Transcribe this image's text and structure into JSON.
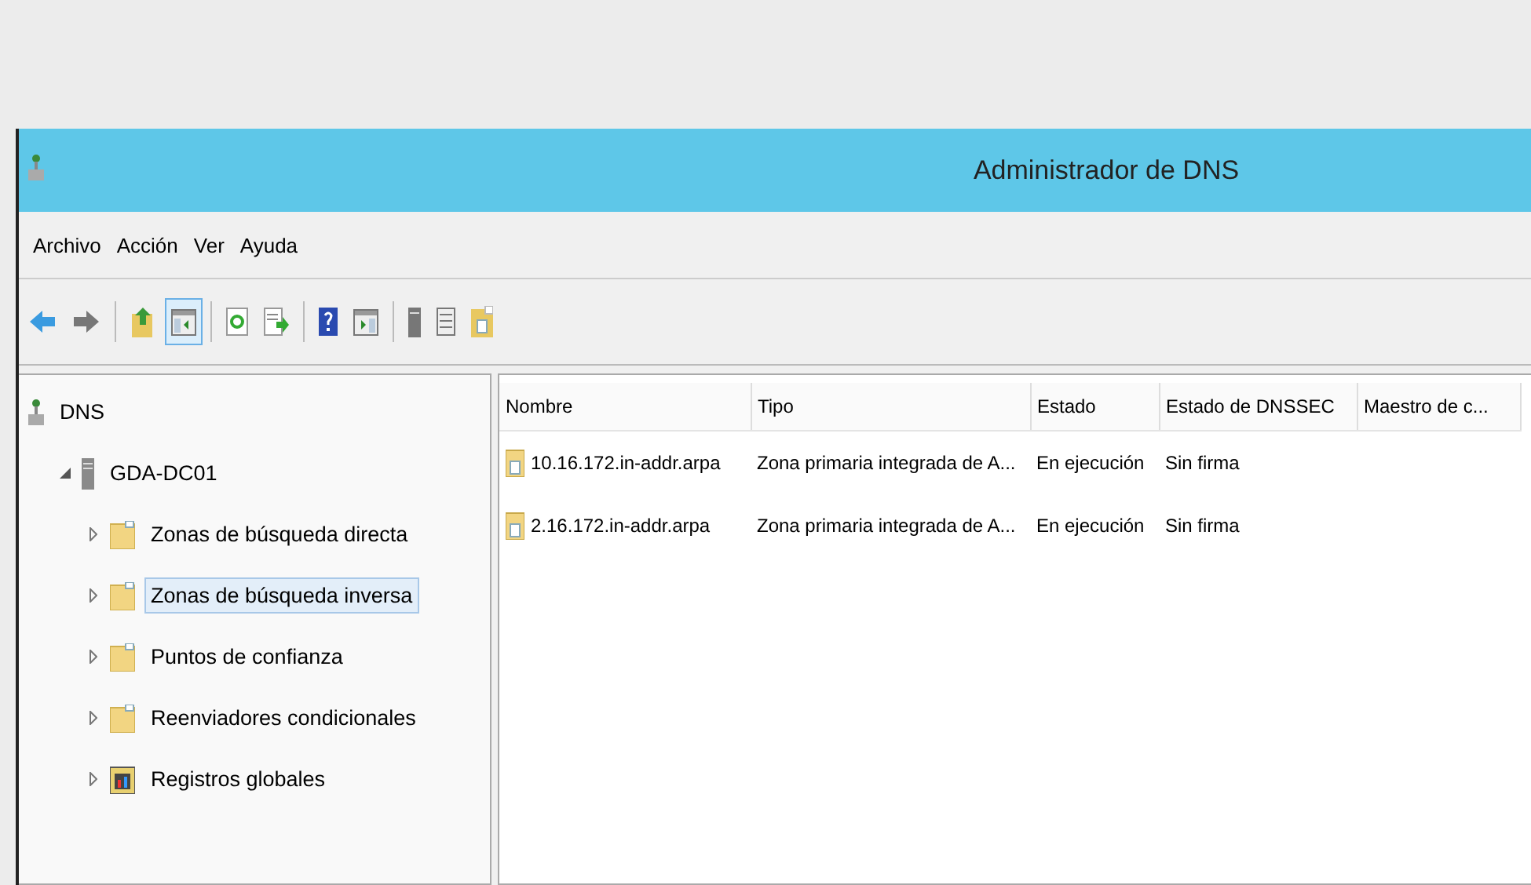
{
  "window": {
    "title": "Administrador de DNS"
  },
  "menu": [
    "Archivo",
    "Acción",
    "Ver",
    "Ayuda"
  ],
  "toolbar": [
    {
      "kind": "back",
      "pressed": false
    },
    {
      "kind": "forward",
      "pressed": false
    },
    {
      "kind": "sep"
    },
    {
      "kind": "up",
      "pressed": false
    },
    {
      "kind": "tree",
      "pressed": true
    },
    {
      "kind": "sep"
    },
    {
      "kind": "refresh",
      "pressed": false
    },
    {
      "kind": "export",
      "pressed": false
    },
    {
      "kind": "sep"
    },
    {
      "kind": "help",
      "pressed": false
    },
    {
      "kind": "pane",
      "pressed": false
    },
    {
      "kind": "sep"
    },
    {
      "kind": "server",
      "pressed": false
    },
    {
      "kind": "list",
      "pressed": false
    },
    {
      "kind": "file",
      "pressed": false
    }
  ],
  "tree": [
    {
      "label": "DNS",
      "kind": "dns",
      "selected": false,
      "children": [
        {
          "label": "GDA-DC01",
          "kind": "server",
          "expanded": true,
          "selected": false,
          "children": [
            {
              "label": "Zonas de búsqueda directa",
              "kind": "folder",
              "expanded": false,
              "selected": false
            },
            {
              "label": "Zonas de búsqueda inversa",
              "kind": "folder",
              "expanded": false,
              "selected": true
            },
            {
              "label": "Puntos de confianza",
              "kind": "folder",
              "expanded": false,
              "selected": false
            },
            {
              "label": "Reenviadores condicionales",
              "kind": "folder",
              "expanded": false,
              "selected": false
            },
            {
              "label": "Registros globales",
              "kind": "records",
              "expanded": false,
              "selected": false
            }
          ]
        }
      ]
    }
  ],
  "table": {
    "columns": [
      "Nombre",
      "Tipo",
      "Estado",
      "Estado de DNSSEC",
      "Maestro de c..."
    ],
    "rows": [
      [
        "10.16.172.in-addr.arpa",
        "Zona primaria integrada de A...",
        "En ejecución",
        "Sin firma"
      ],
      [
        "2.16.172.in-addr.arpa",
        "Zona primaria integrada de A...",
        "En ejecución",
        "Sin firma"
      ]
    ]
  }
}
